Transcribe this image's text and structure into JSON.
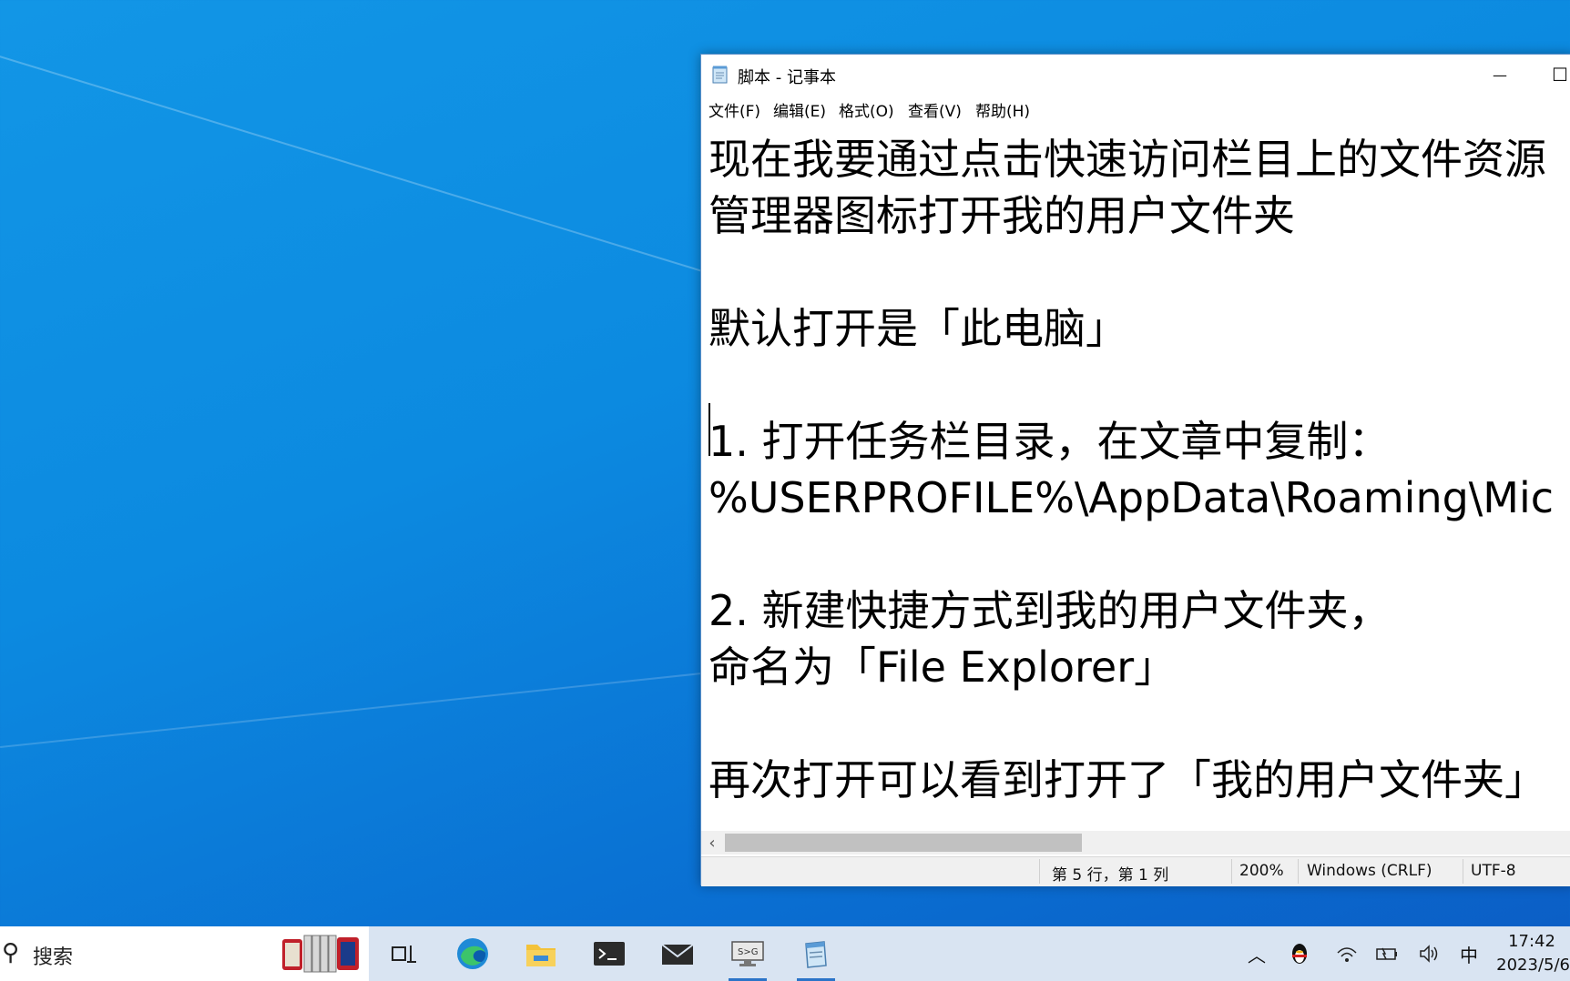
{
  "window": {
    "title": "脚本 - 记事本",
    "minimize_glyph": "—",
    "maximize_glyph": "☐"
  },
  "menu": [
    "文件(F)",
    "编辑(E)",
    "格式(O)",
    "查看(V)",
    "帮助(H)"
  ],
  "editor": {
    "lines": [
      "现在我要通过点击快速访问栏目上的文件资源",
      "管理器图标打开我的用户文件夹",
      "",
      "默认打开是「此电脑」",
      "",
      "1. 打开任务栏目录，在文章中复制：",
      "%USERPROFILE%\\AppData\\Roaming\\Mic",
      "",
      "2. 新建快捷方式到我的用户文件夹，",
      "命名为「File Explorer」",
      "",
      "再次打开可以看到打开了「我的用户文件夹」"
    ]
  },
  "statusbar": {
    "position": "第 5 行，第 1 列",
    "zoom": "200%",
    "line_ending": "Windows (CRLF)",
    "encoding": "UTF-8"
  },
  "taskbar": {
    "search_placeholder": "搜索",
    "apps": [
      "task-view",
      "edge",
      "file-explorer",
      "terminal",
      "mail",
      "remote-desktop",
      "notepad"
    ],
    "tray": {
      "ime": "中",
      "time": "17:42",
      "date": "2023/5/6"
    }
  },
  "colors": {
    "desktop": "#0c8ae0",
    "taskbar": "#d9e4f2",
    "accent": "#2b74c8"
  }
}
